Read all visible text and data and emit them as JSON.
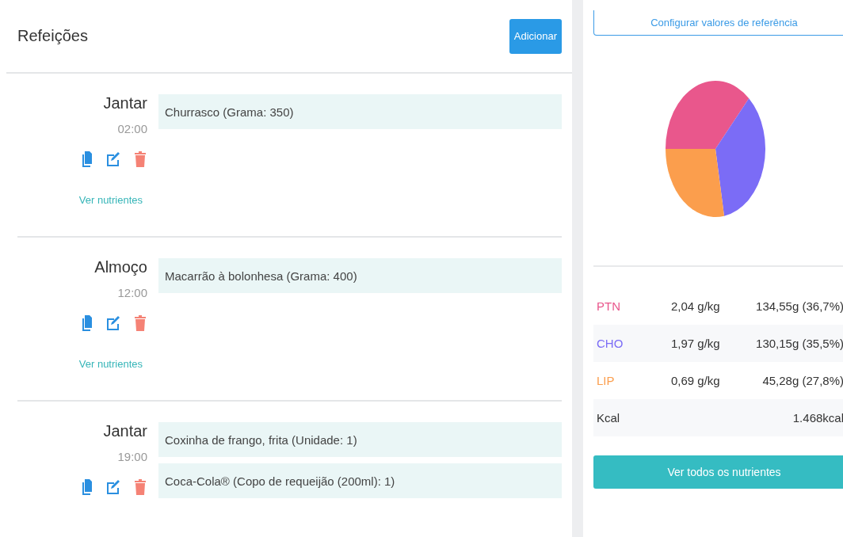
{
  "meals_panel": {
    "title": "Refeições",
    "add_button": "Adicionar",
    "meals": [
      {
        "name": "Jantar",
        "time": "02:00",
        "foods": [
          "Churrasco (Grama: 350)"
        ],
        "link": "Ver nutrientes"
      },
      {
        "name": "Almoço",
        "time": "12:00",
        "foods": [
          "Macarrão à bolonhesa (Grama: 400)"
        ],
        "link": "Ver nutrientes"
      },
      {
        "name": "Jantar",
        "time": "19:00",
        "foods": [
          "Coxinha de frango, frita (Unidade: 1)",
          "Coca-Cola® (Copo de requeijão (200ml): 1)"
        ]
      }
    ]
  },
  "summary_panel": {
    "config_button": "Configurar valores de referência",
    "macros": [
      {
        "label": "PTN",
        "color": "#e9578c",
        "per_kg": "2,04 g/kg",
        "total": "134,55g (36,7%)"
      },
      {
        "label": "CHO",
        "color": "#7b6cf6",
        "per_kg": "1,97 g/kg",
        "total": "130,15g (35,5%)"
      },
      {
        "label": "LIP",
        "color": "#fb9e4d",
        "per_kg": "0,69 g/kg",
        "total": "45,28g (27,8%)"
      },
      {
        "label": "Kcal",
        "total": "1.468kcal"
      }
    ],
    "all_button": "Ver todos os nutrientes"
  }
}
